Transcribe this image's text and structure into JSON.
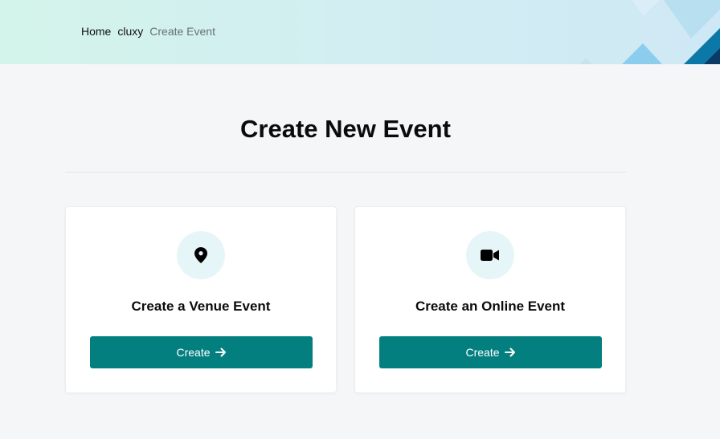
{
  "breadcrumb": {
    "items": [
      "Home",
      "cluxy"
    ],
    "current": "Create Event"
  },
  "page": {
    "title": "Create New Event"
  },
  "cards": [
    {
      "title": "Create a Venue Event",
      "icon": "map-pin-icon",
      "button_label": "Create"
    },
    {
      "title": "Create an Online Event",
      "icon": "video-camera-icon",
      "button_label": "Create"
    }
  ],
  "colors": {
    "accent": "#047f80",
    "icon_bg": "#e6f5f7",
    "page_bg": "#f5f6f8"
  }
}
